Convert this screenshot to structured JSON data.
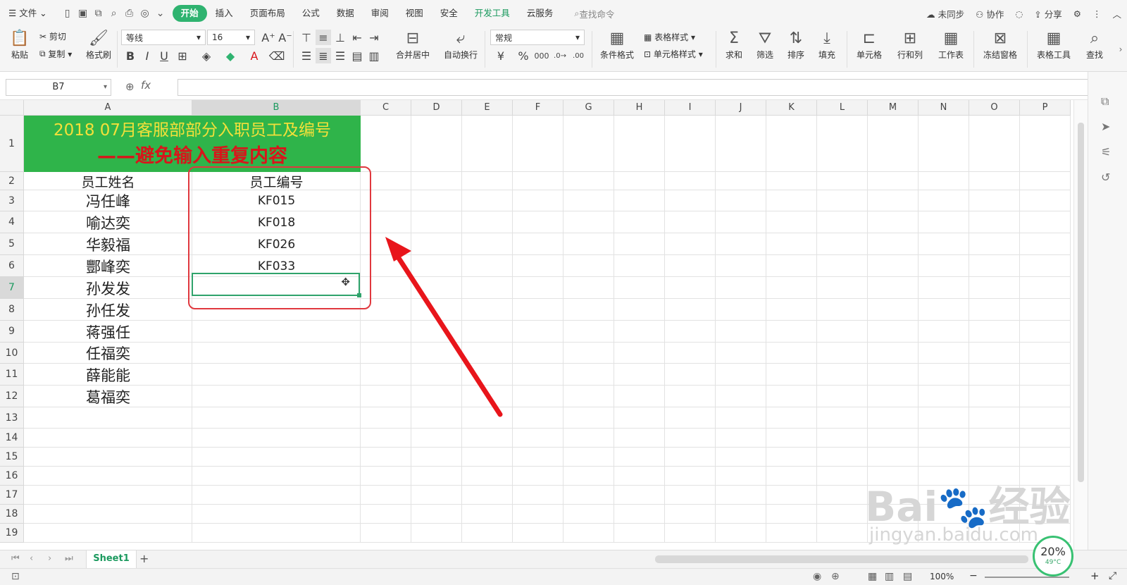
{
  "menubar": {
    "file_label": "文件",
    "tabs": [
      "开始",
      "插入",
      "页面布局",
      "公式",
      "数据",
      "审阅",
      "视图",
      "安全",
      "开发工具",
      "云服务"
    ],
    "search_placeholder": "查找命令",
    "right": {
      "unsynced": "未同步",
      "collab": "协作",
      "share": "分享"
    }
  },
  "ribbon": {
    "paste": "粘贴",
    "cut": "剪切",
    "copy": "复制",
    "format_painter": "格式刷",
    "font_name": "等线",
    "font_size": "16",
    "merge_center": "合并居中",
    "wrap_text": "自动换行",
    "number_format": "常规",
    "cond_format": "条件格式",
    "table_style": "表格样式",
    "cell_style": "单元格样式",
    "sum": "求和",
    "filter": "筛选",
    "sort": "排序",
    "fill": "填充",
    "cell": "单元格",
    "row_col": "行和列",
    "worksheet": "工作表",
    "freeze": "冻结窗格",
    "table_tools": "表格工具",
    "find": "查找"
  },
  "formula_bar": {
    "name_box": "B7",
    "fx": "fx",
    "formula": ""
  },
  "columns": [
    "A",
    "B",
    "C",
    "D",
    "E",
    "F",
    "G",
    "H",
    "I",
    "J",
    "K",
    "L",
    "M",
    "N",
    "O",
    "P"
  ],
  "rows": [
    "1",
    "2",
    "3",
    "4",
    "5",
    "6",
    "7",
    "8",
    "9",
    "10",
    "11",
    "12",
    "13",
    "14",
    "15",
    "16",
    "17",
    "18",
    "19"
  ],
  "sheet": {
    "title_line1": "2018 07月客服部部分入职员工及编号",
    "title_line2": "——避免输入重复内容",
    "header_name": "员工姓名",
    "header_id": "员工编号",
    "names": [
      "冯任峰",
      "喻达奕",
      "华毅福",
      "酆峰奕",
      "孙发发",
      "孙任发",
      "蒋强任",
      "任福奕",
      "薛能能",
      "葛福奕"
    ],
    "ids": [
      "KF015",
      "KF018",
      "KF026",
      "KF033"
    ]
  },
  "tabs": {
    "sheet_name": "Sheet1",
    "add": "+"
  },
  "status": {
    "zoom": "100%",
    "perf_percent": "20%",
    "perf_temp": "49°C"
  },
  "watermark": {
    "brand": "Bai",
    "brand2": "经验",
    "url": "jingyan.baidu.com"
  },
  "colors": {
    "accent": "#2fb370",
    "title_bg": "#2fb44a",
    "title_line1": "#f3e03a",
    "title_line2": "#d8151b",
    "annotation": "#e0383e",
    "selection": "#2fa36b"
  }
}
